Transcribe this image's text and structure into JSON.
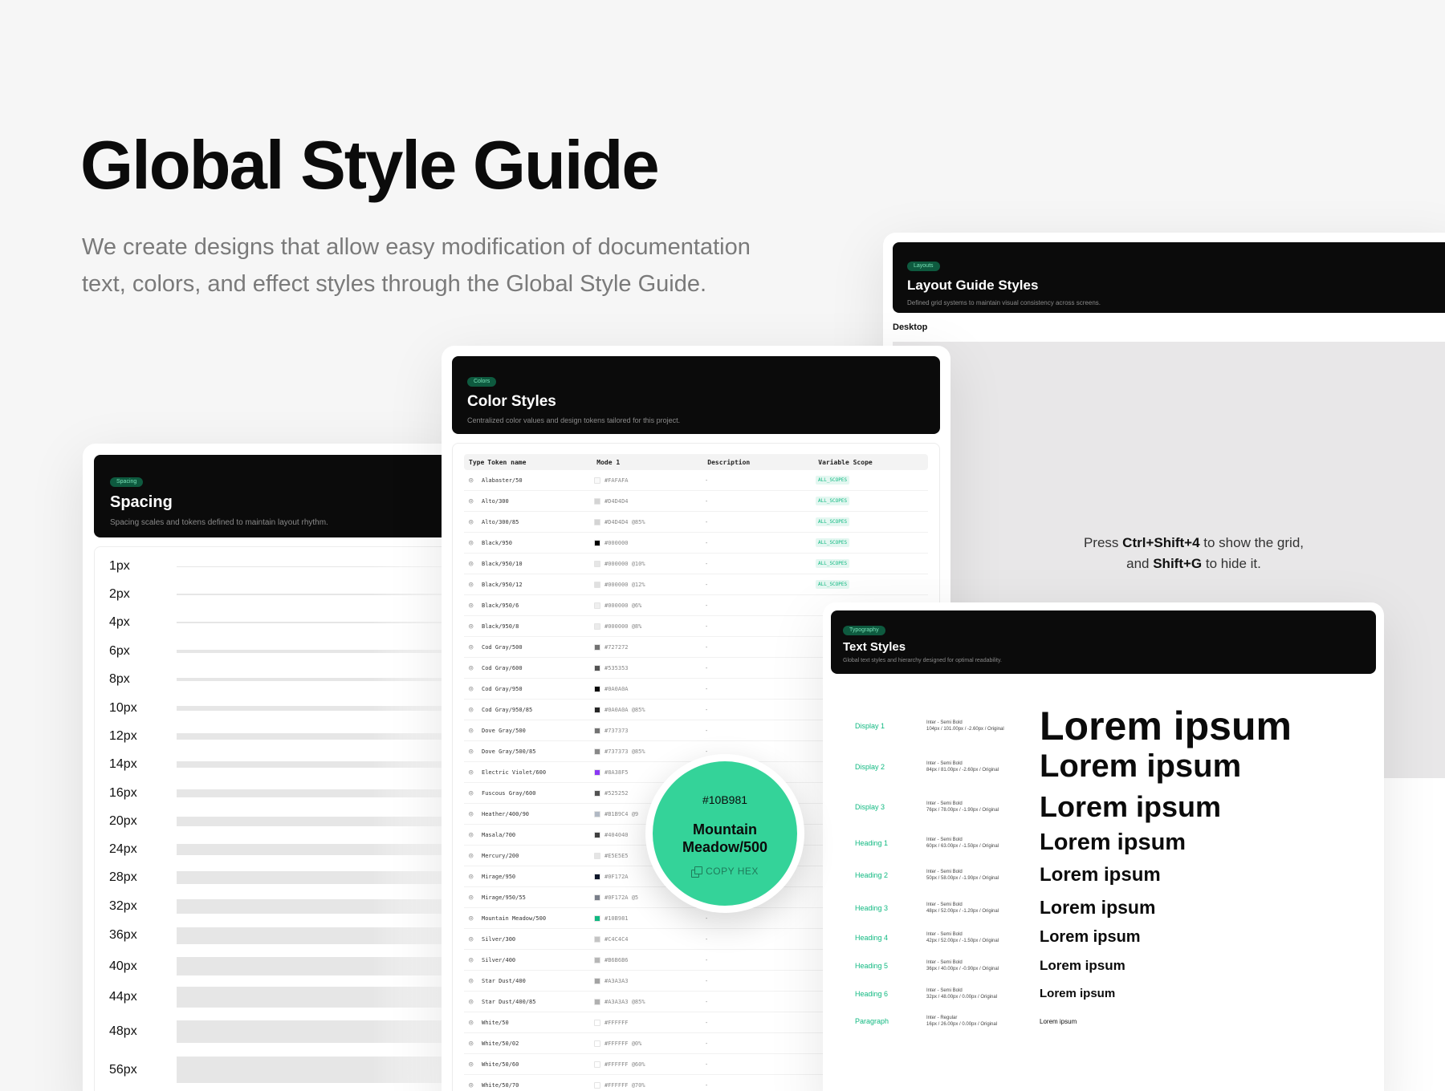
{
  "hero": {
    "title": "Global Style Guide",
    "subtitle": "We create designs that allow easy modification of documentation text, colors, and effect styles through the Global Style Guide."
  },
  "layout": {
    "badge": "Layouts",
    "title": "Layout Guide Styles",
    "description": "Defined grid systems to maintain visual consistency across screens.",
    "section": "Desktop",
    "hint_press": "Press",
    "hint_key1": "Ctrl+Shift+4",
    "hint_mid": "to show the grid, and",
    "hint_key2": "Shift+G",
    "hint_end": "to hide it."
  },
  "spacing": {
    "badge": "Spacing",
    "title": "Spacing",
    "description": "Spacing scales and tokens defined to maintain layout rhythm.",
    "items": [
      {
        "label": "1px",
        "size": 1
      },
      {
        "label": "2px",
        "size": 2
      },
      {
        "label": "4px",
        "size": 4
      },
      {
        "label": "6px",
        "size": 6
      },
      {
        "label": "8px",
        "size": 8
      },
      {
        "label": "10px",
        "size": 10
      },
      {
        "label": "12px",
        "size": 12
      },
      {
        "label": "14px",
        "size": 14
      },
      {
        "label": "16px",
        "size": 16
      },
      {
        "label": "20px",
        "size": 20
      },
      {
        "label": "24px",
        "size": 24
      },
      {
        "label": "28px",
        "size": 28
      },
      {
        "label": "32px",
        "size": 32
      },
      {
        "label": "36px",
        "size": 36
      },
      {
        "label": "40px",
        "size": 40
      },
      {
        "label": "44px",
        "size": 44
      },
      {
        "label": "48px",
        "size": 48
      },
      {
        "label": "56px",
        "size": 56
      }
    ]
  },
  "colors": {
    "badge": "Colors",
    "title": "Color Styles",
    "description": "Centralized color values and design tokens tailored for this project.",
    "columns": [
      "Type",
      "Token name",
      "Mode 1",
      "Description",
      "Variable Scope"
    ],
    "type_icon": "palette-icon",
    "rows": [
      {
        "name": "Alabaster/50",
        "value": "#FAFAFA",
        "swatch": "#FAFAFA",
        "desc": "-",
        "scope": "ALL_SCOPES"
      },
      {
        "name": "Alto/300",
        "value": "#D4D4D4",
        "swatch": "#D4D4D4",
        "desc": "-",
        "scope": "ALL_SCOPES"
      },
      {
        "name": "Alto/300/85",
        "value": "#D4D4D4 @85%",
        "swatch": "#D4D4D4",
        "desc": "-",
        "scope": "ALL_SCOPES"
      },
      {
        "name": "Black/950",
        "value": "#000000",
        "swatch": "#000000",
        "desc": "-",
        "scope": "ALL_SCOPES"
      },
      {
        "name": "Black/950/10",
        "value": "#000000 @10%",
        "swatch": "#e6e6e6",
        "desc": "-",
        "scope": "ALL_SCOPES"
      },
      {
        "name": "Black/950/12",
        "value": "#000000 @12%",
        "swatch": "#e0e0e0",
        "desc": "-",
        "scope": "ALL_SCOPES"
      },
      {
        "name": "Black/950/6",
        "value": "#000000 @6%",
        "swatch": "#efefef",
        "desc": "-",
        "scope": ""
      },
      {
        "name": "Black/950/8",
        "value": "#000000 @8%",
        "swatch": "#ebebeb",
        "desc": "-",
        "scope": ""
      },
      {
        "name": "Cod Gray/500",
        "value": "#727272",
        "swatch": "#727272",
        "desc": "-",
        "scope": ""
      },
      {
        "name": "Cod Gray/600",
        "value": "#535353",
        "swatch": "#535353",
        "desc": "-",
        "scope": ""
      },
      {
        "name": "Cod Gray/950",
        "value": "#0A0A0A",
        "swatch": "#0A0A0A",
        "desc": "-",
        "scope": ""
      },
      {
        "name": "Cod Gray/950/85",
        "value": "#0A0A0A @85%",
        "swatch": "#262626",
        "desc": "-",
        "scope": ""
      },
      {
        "name": "Dove Gray/500",
        "value": "#737373",
        "swatch": "#737373",
        "desc": "-",
        "scope": ""
      },
      {
        "name": "Dove Gray/500/85",
        "value": "#737373 @85%",
        "swatch": "#888888",
        "desc": "-",
        "scope": ""
      },
      {
        "name": "Electric Violet/600",
        "value": "#8A38F5",
        "swatch": "#8A38F5",
        "desc": "-",
        "scope": ""
      },
      {
        "name": "Fuscous Gray/600",
        "value": "#525252",
        "swatch": "#525252",
        "desc": "-",
        "scope": ""
      },
      {
        "name": "Heather/400/90",
        "value": "#B1B9C4 @9",
        "swatch": "#B1B9C4",
        "desc": "-",
        "scope": ""
      },
      {
        "name": "Masala/700",
        "value": "#404040",
        "swatch": "#404040",
        "desc": "-",
        "scope": ""
      },
      {
        "name": "Mercury/200",
        "value": "#E5E5E5",
        "swatch": "#E5E5E5",
        "desc": "-",
        "scope": ""
      },
      {
        "name": "Mirage/950",
        "value": "#0F172A",
        "swatch": "#0F172A",
        "desc": "-",
        "scope": ""
      },
      {
        "name": "Mirage/950/55",
        "value": "#0F172A @5",
        "swatch": "#7a7f8a",
        "desc": "-",
        "scope": ""
      },
      {
        "name": "Mountain Meadow/500",
        "value": "#10B981",
        "swatch": "#10B981",
        "desc": "-",
        "scope": ""
      },
      {
        "name": "Silver/300",
        "value": "#C4C4C4",
        "swatch": "#C4C4C4",
        "desc": "-",
        "scope": ""
      },
      {
        "name": "Silver/400",
        "value": "#B6B6B6",
        "swatch": "#B6B6B6",
        "desc": "-",
        "scope": ""
      },
      {
        "name": "Star Dust/400",
        "value": "#A3A3A3",
        "swatch": "#A3A3A3",
        "desc": "-",
        "scope": ""
      },
      {
        "name": "Star Dust/400/85",
        "value": "#A3A3A3 @85%",
        "swatch": "#B0B0B0",
        "desc": "-",
        "scope": ""
      },
      {
        "name": "White/50",
        "value": "#FFFFFF",
        "swatch": "#FFFFFF",
        "desc": "-",
        "scope": ""
      },
      {
        "name": "White/50/02",
        "value": "#FFFFFF @0%",
        "swatch": "#FFFFFF",
        "desc": "-",
        "scope": ""
      },
      {
        "name": "White/50/60",
        "value": "#FFFFFF @60%",
        "swatch": "#FFFFFF",
        "desc": "-",
        "scope": ""
      },
      {
        "name": "White/50/70",
        "value": "#FFFFFF @70%",
        "swatch": "#FFFFFF",
        "desc": "-",
        "scope": ""
      }
    ]
  },
  "bubble": {
    "hex": "#10B981",
    "name": "Mountain Meadow/500",
    "copy": "COPY HEX",
    "fill": "#34D399"
  },
  "text_styles": {
    "badge": "Typography",
    "title": "Text Styles",
    "description": "Global text styles and hierarchy designed for optimal readability.",
    "sample": "Lorem ipsum",
    "rows": [
      {
        "name": "Display 1",
        "font": "Inter - Semi Bold",
        "spec": "104px / 101.00px / -2.60px / Original",
        "size": 104
      },
      {
        "name": "Display 2",
        "font": "Inter - Semi Bold",
        "spec": "84px / 81.00px / -2.60px / Original",
        "size": 84
      },
      {
        "name": "Display 3",
        "font": "Inter - Semi Bold",
        "spec": "76px / 78.00px / -1.90px / Original",
        "size": 76
      },
      {
        "name": "Heading 1",
        "font": "Inter - Semi Bold",
        "spec": "60px / 63.00px / -1.50px / Original",
        "size": 60
      },
      {
        "name": "Heading 2",
        "font": "Inter - Semi Bold",
        "spec": "50px / 58.00px / -1.90px / Original",
        "size": 50
      },
      {
        "name": "Heading 3",
        "font": "Inter - Semi Bold",
        "spec": "48px / 52.00px / -1.20px / Original",
        "size": 48
      },
      {
        "name": "Heading 4",
        "font": "Inter - Semi Bold",
        "spec": "42px / 52.00px / -1.50px / Original",
        "size": 42
      },
      {
        "name": "Heading 5",
        "font": "Inter - Semi Bold",
        "spec": "36px / 40.00px / -0.90px / Original",
        "size": 36
      },
      {
        "name": "Heading 6",
        "font": "Inter - Semi Bold",
        "spec": "32px / 48.00px / 0.00px / Original",
        "size": 32
      },
      {
        "name": "Paragraph",
        "font": "Inter - Regular",
        "spec": "16px / 26.00px / 0.00px / Original",
        "size": 16
      }
    ]
  }
}
